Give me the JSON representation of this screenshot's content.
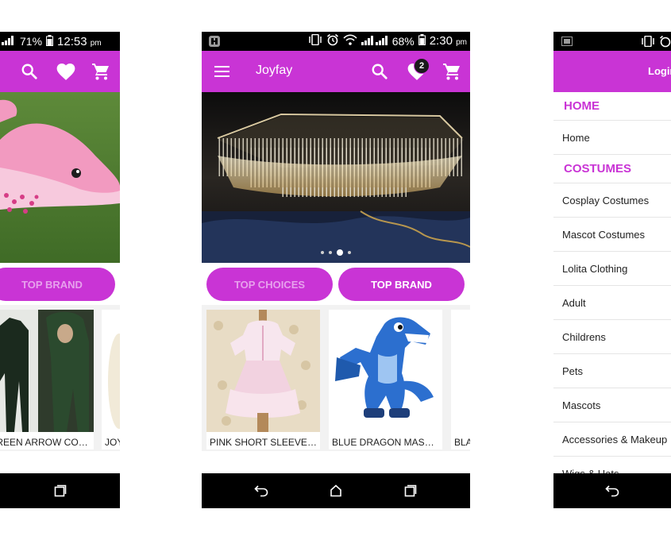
{
  "colors": {
    "accent": "#c934d5",
    "accent_dim_text": "#e7a1ed",
    "bar": "#000000"
  },
  "screen_left": {
    "status": {
      "battery": "71%",
      "time": "12:53",
      "ampm": "pm"
    },
    "icons": [
      "search-icon",
      "heart-icon",
      "cart-icon"
    ],
    "buttons": {
      "top_brand": "TOP BRAND"
    },
    "products": [
      {
        "name": "GREEN ARROW COSTUMES"
      },
      {
        "name": "JOY"
      }
    ]
  },
  "screen_center": {
    "status": {
      "battery": "68%",
      "time": "2:30",
      "ampm": "pm"
    },
    "appbar": {
      "title": "Joyfay",
      "wishlist_badge": "2"
    },
    "icons": [
      "menu-icon",
      "search-icon",
      "heart-icon",
      "cart-icon"
    ],
    "carousel": {
      "dots": 4,
      "active_dot": 3
    },
    "buttons": {
      "top_choices": "TOP CHOICES",
      "top_brand": "TOP BRAND"
    },
    "products": [
      {
        "name": "PINK SHORT SLEEVES LOLITA DRESS"
      },
      {
        "name": "BLUE DRAGON MASCOT COSTUME"
      },
      {
        "name": "BLA"
      }
    ]
  },
  "screen_right": {
    "appbar": {
      "title": "Login"
    },
    "menu": {
      "home_header": "HOME",
      "home_items": [
        "Home"
      ],
      "costumes_header": "COSTUMES",
      "costume_items": [
        "Cosplay Costumes",
        "Mascot Costumes",
        "Lolita Clothing",
        "Adult",
        "Childrens",
        "Pets",
        "Mascots",
        "Accessories & Makeup",
        "Wigs & Hats"
      ]
    }
  }
}
